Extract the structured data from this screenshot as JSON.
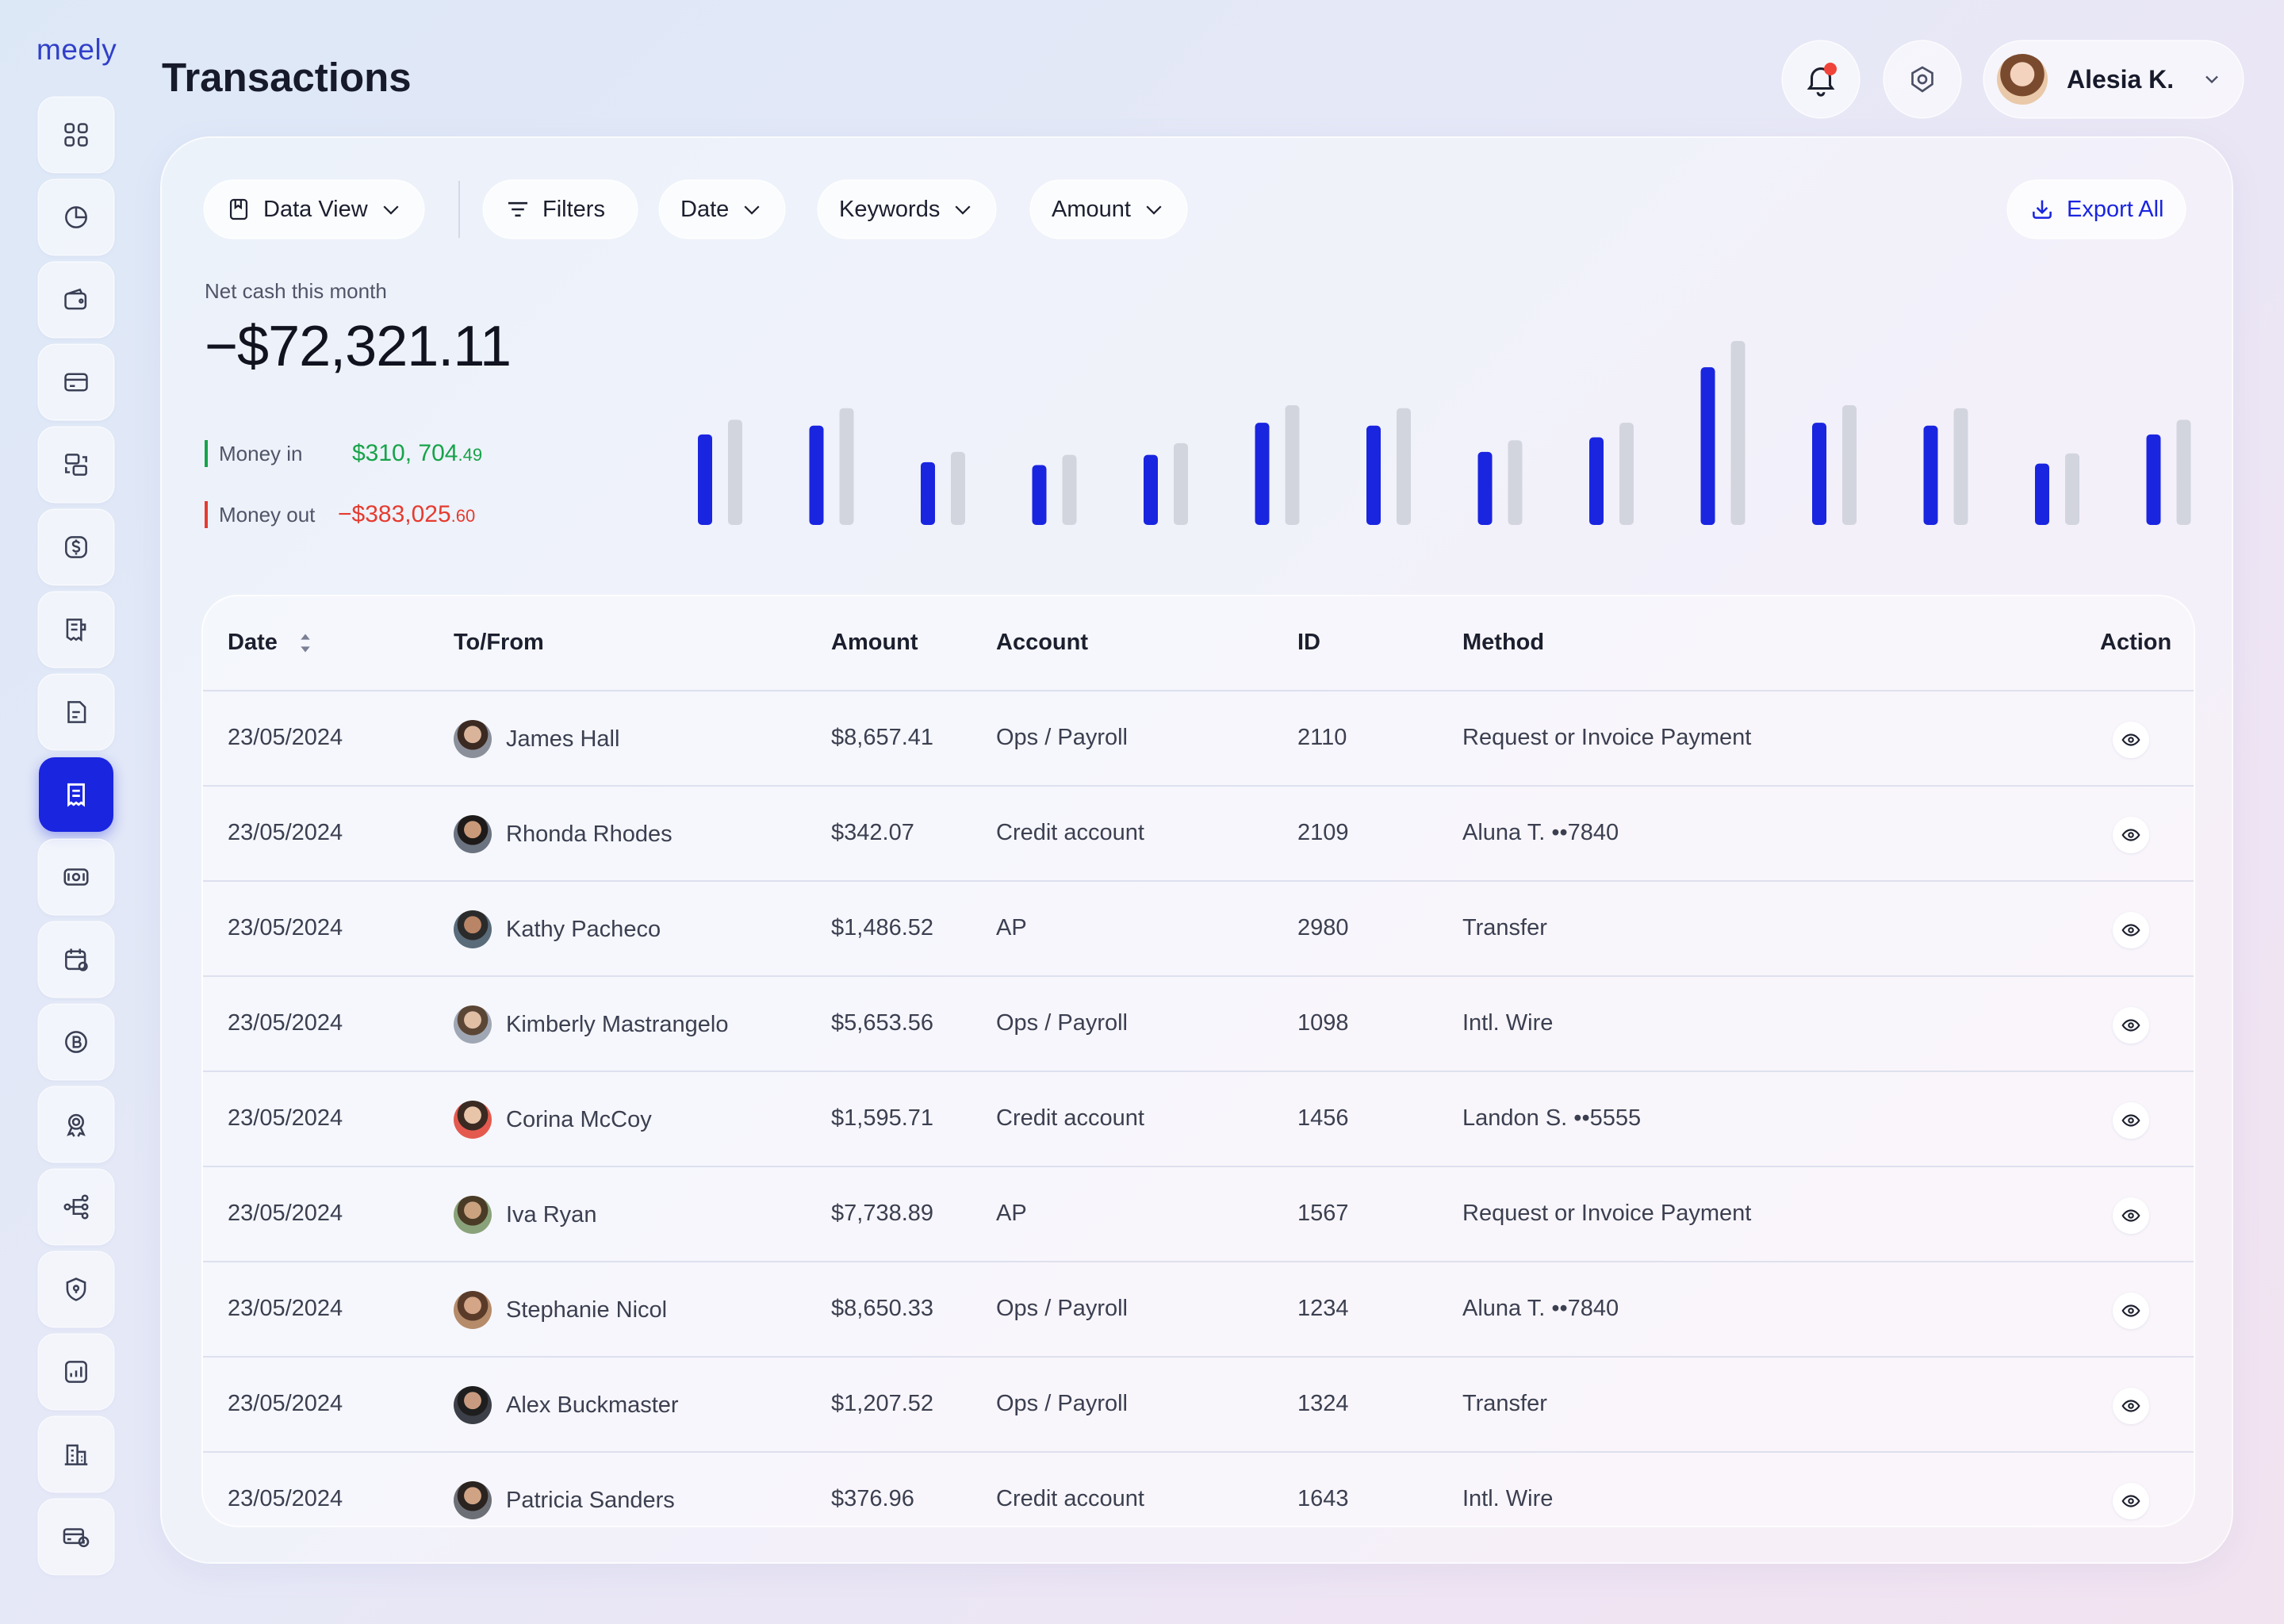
{
  "app": {
    "logo": "meely"
  },
  "page": {
    "title": "Transactions"
  },
  "header": {
    "user_name": "Alesia K.",
    "has_notifications": true
  },
  "sidebar": {
    "items": [
      {
        "icon": "grid-icon",
        "active": false
      },
      {
        "icon": "pie-chart-icon",
        "active": false
      },
      {
        "icon": "wallet-icon",
        "active": false
      },
      {
        "icon": "credit-card-icon",
        "active": false
      },
      {
        "icon": "exchange-icon",
        "active": false
      },
      {
        "icon": "dollar-icon",
        "active": false
      },
      {
        "icon": "receipt-icon",
        "active": false
      },
      {
        "icon": "document-icon",
        "active": false
      },
      {
        "icon": "transactions-icon",
        "active": true
      },
      {
        "icon": "cash-icon",
        "active": false
      },
      {
        "icon": "calendar-icon",
        "active": false
      },
      {
        "icon": "bitcoin-icon",
        "active": false
      },
      {
        "icon": "award-icon",
        "active": false
      },
      {
        "icon": "flow-icon",
        "active": false
      },
      {
        "icon": "shield-icon",
        "active": false
      },
      {
        "icon": "analytics-icon",
        "active": false
      },
      {
        "icon": "building-icon",
        "active": false
      },
      {
        "icon": "cards-icon",
        "active": false
      }
    ]
  },
  "toolbar": {
    "data_view": "Data View",
    "filters": "Filters",
    "date": "Date",
    "keywords": "Keywords",
    "amount": "Amount",
    "export": "Export All"
  },
  "summary": {
    "net_label": "Net cash this month",
    "net_value": "−$72,321.11",
    "money_in_label": "Money in",
    "money_in_value": "$310, 704",
    "money_in_cents": ".49",
    "money_out_label": "Money out",
    "money_out_value": "−$383,025",
    "money_out_cents": ".60"
  },
  "chart_data": {
    "type": "bar",
    "series": [
      {
        "values": [
          62,
          68,
          43,
          41,
          48,
          70,
          68,
          50,
          60,
          108,
          70,
          68,
          42,
          62
        ]
      },
      {
        "values": [
          72,
          80,
          50,
          48,
          56,
          82,
          80,
          58,
          70,
          126,
          82,
          80,
          49,
          72
        ]
      }
    ],
    "colors": [
      "#1a25e0",
      "#d3d5de"
    ]
  },
  "table": {
    "headers": {
      "date": "Date",
      "to_from": "To/From",
      "amount": "Amount",
      "account": "Account",
      "id": "ID",
      "method": "Method",
      "action": "Action"
    },
    "rows": [
      {
        "date": "23/05/2024",
        "name": "James Hall",
        "amount": "$8,657.41",
        "account": "Ops / Payroll",
        "id": "2110",
        "method": "Request or Invoice Payment"
      },
      {
        "date": "23/05/2024",
        "name": "Rhonda Rhodes",
        "amount": "$342.07",
        "account": "Credit account",
        "id": "2109",
        "method": "Aluna T. ••7840"
      },
      {
        "date": "23/05/2024",
        "name": "Kathy Pacheco",
        "amount": "$1,486.52",
        "account": "AP",
        "id": "2980",
        "method": "Transfer"
      },
      {
        "date": "23/05/2024",
        "name": "Kimberly Mastrangelo",
        "amount": "$5,653.56",
        "account": "Ops / Payroll",
        "id": "1098",
        "method": "Intl. Wire"
      },
      {
        "date": "23/05/2024",
        "name": "Corina McCoy",
        "amount": "$1,595.71",
        "account": "Credit account",
        "id": "1456",
        "method": "Landon S. ••5555"
      },
      {
        "date": "23/05/2024",
        "name": "Iva Ryan",
        "amount": "$7,738.89",
        "account": "AP",
        "id": "1567",
        "method": "Request or Invoice Payment"
      },
      {
        "date": "23/05/2024",
        "name": "Stephanie Nicol",
        "amount": "$8,650.33",
        "account": "Ops / Payroll",
        "id": "1234",
        "method": "Aluna T. ••7840"
      },
      {
        "date": "23/05/2024",
        "name": "Alex Buckmaster",
        "amount": "$1,207.52",
        "account": "Ops / Payroll",
        "id": "1324",
        "method": "Transfer"
      },
      {
        "date": "23/05/2024",
        "name": "Patricia Sanders",
        "amount": "$376.96",
        "account": "Credit account",
        "id": "1643",
        "method": "Intl. Wire"
      }
    ]
  }
}
